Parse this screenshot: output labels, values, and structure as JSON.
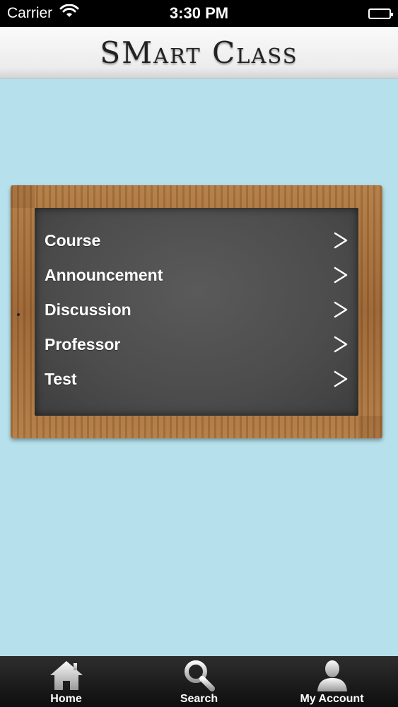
{
  "status_bar": {
    "carrier": "Carrier",
    "time": "3:30 PM",
    "wifi_icon": "wifi-icon",
    "battery_icon": "battery-icon"
  },
  "header": {
    "title": "SMart Class"
  },
  "menu": {
    "items": [
      {
        "label": "Course",
        "icon": "chevron-right-icon"
      },
      {
        "label": "Announcement",
        "icon": "chevron-right-icon"
      },
      {
        "label": "Discussion",
        "icon": "chevron-right-icon"
      },
      {
        "label": "Professor",
        "icon": "chevron-right-icon"
      },
      {
        "label": "Test",
        "icon": "chevron-right-icon"
      }
    ]
  },
  "tab_bar": {
    "tabs": [
      {
        "label": "Home",
        "icon": "home-icon"
      },
      {
        "label": "Search",
        "icon": "search-icon"
      },
      {
        "label": "My Account",
        "icon": "user-icon"
      }
    ]
  },
  "colors": {
    "background": "#b5e0ec",
    "frame_wood": "#a46b37",
    "chalkboard": "#4c4c4c",
    "tab_bar": "#1a1a1a"
  }
}
